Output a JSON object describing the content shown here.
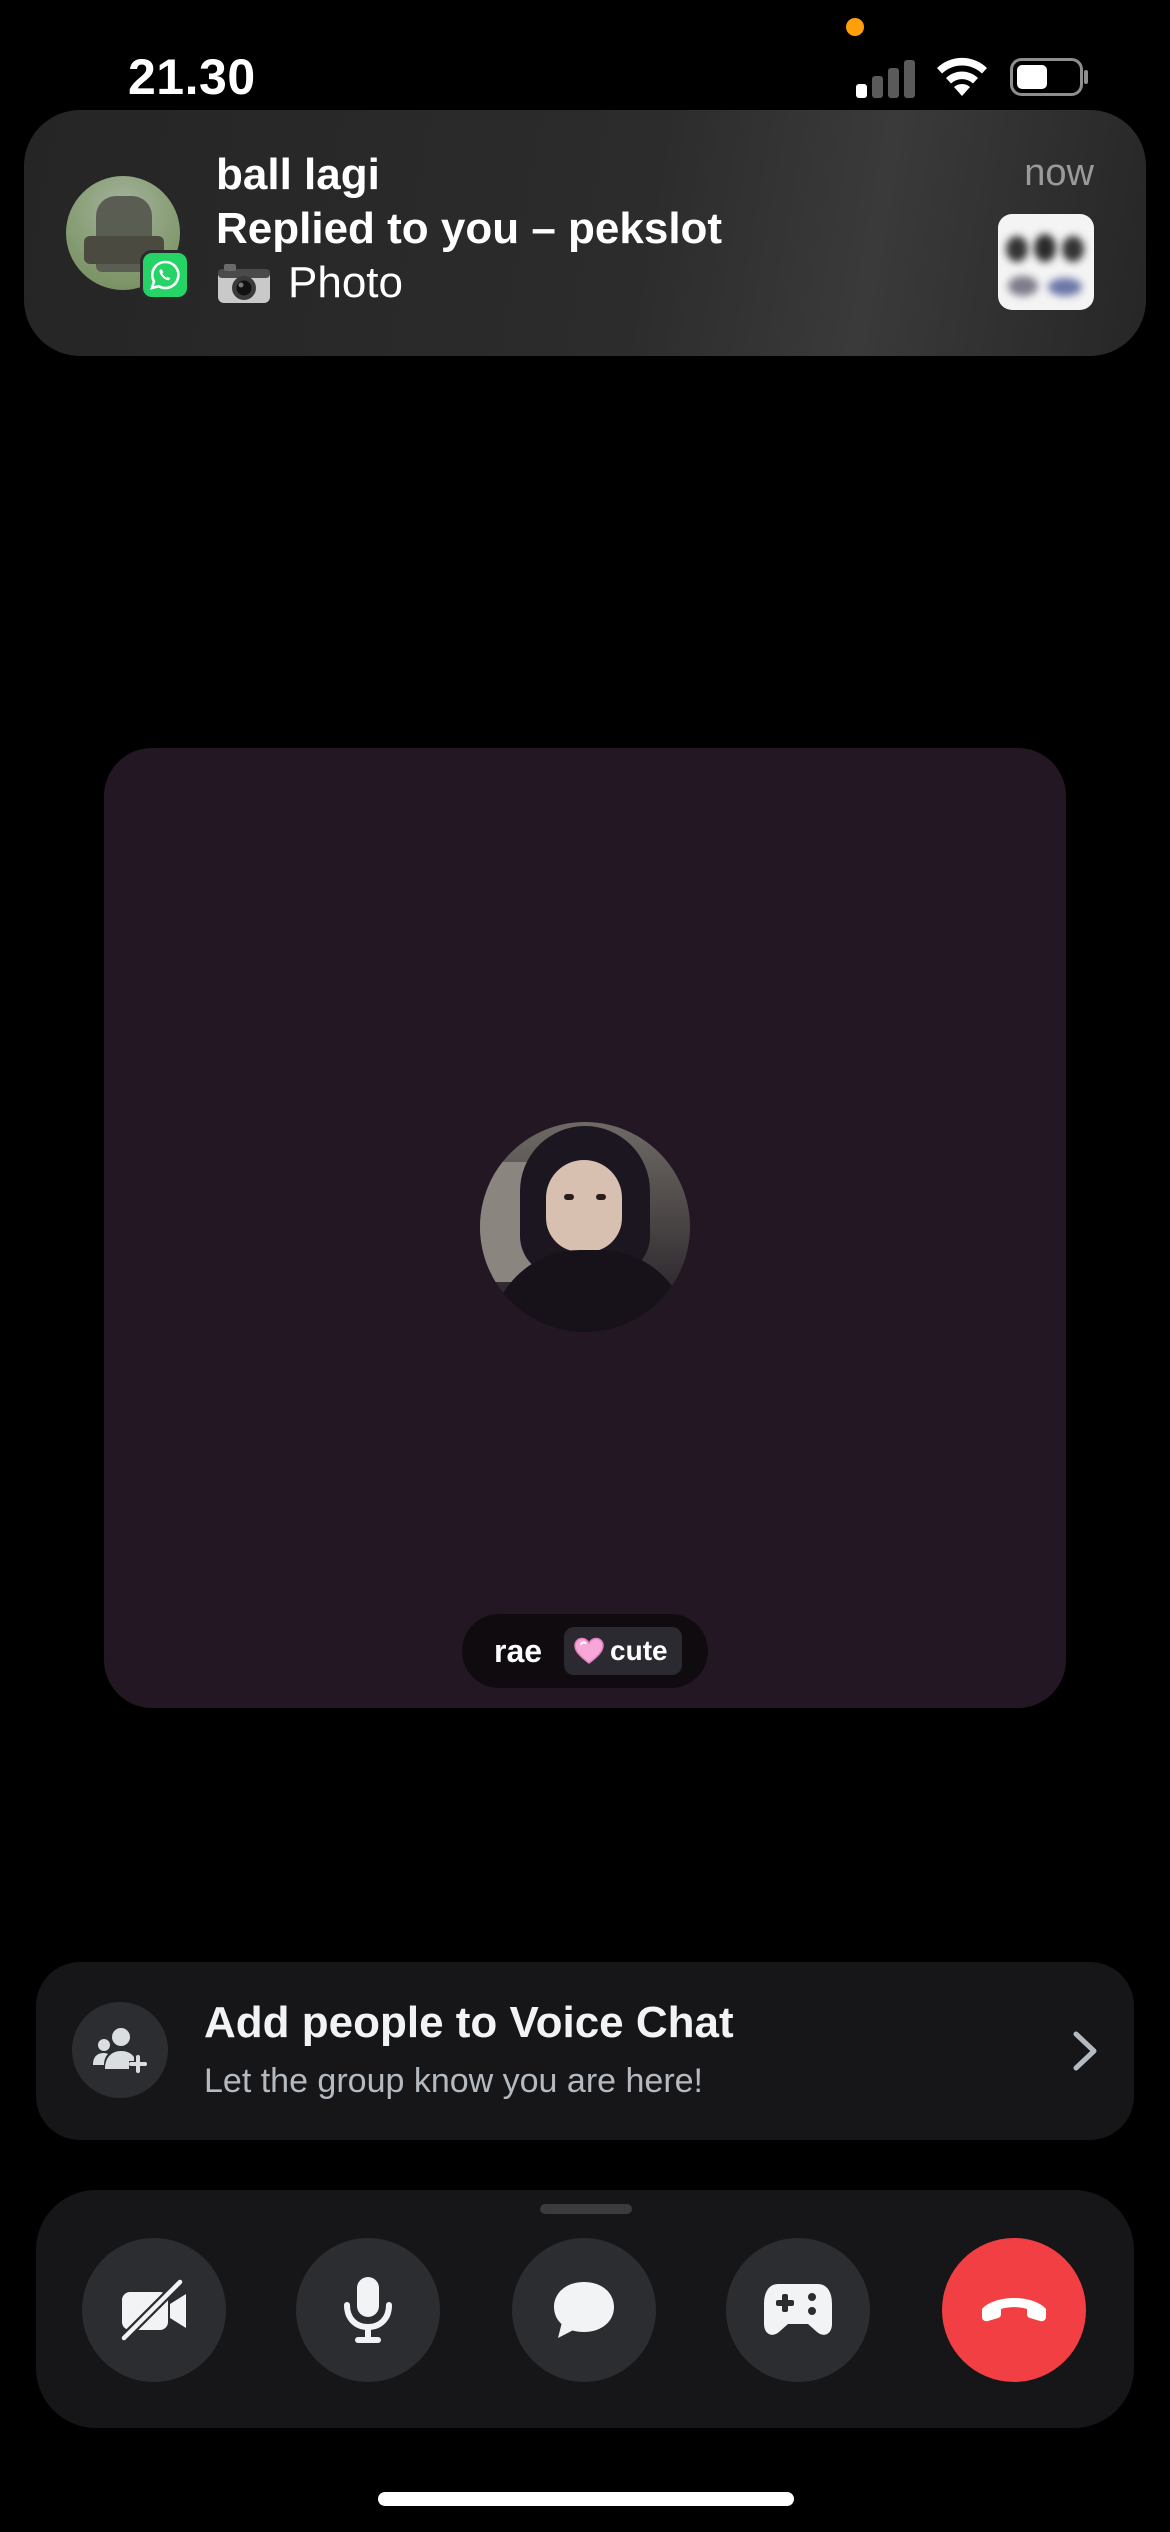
{
  "status_bar": {
    "time": "21.30",
    "privacy_dot_color": "#ff9f0a",
    "icons": [
      "cellular-signal-icon",
      "wifi-icon",
      "battery-icon"
    ]
  },
  "notification": {
    "app_icon": "whatsapp-icon",
    "title": "ball lagi",
    "subtitle": "Replied to you – pekslot",
    "body_icon": "camera-icon",
    "body": "Photo",
    "time": "now"
  },
  "call": {
    "participant": {
      "name": "rae",
      "tag_icon": "heart-icon",
      "tag": "cute"
    },
    "tile_color": "#221722"
  },
  "add_people": {
    "icon": "add-person-icon",
    "title": "Add people to Voice Chat",
    "subtitle": "Let the group know you are here!"
  },
  "controls": {
    "buttons": [
      {
        "name": "camera-off-button",
        "icon": "video-off-icon"
      },
      {
        "name": "mute-button",
        "icon": "microphone-icon"
      },
      {
        "name": "chat-button",
        "icon": "chat-bubble-icon"
      },
      {
        "name": "activities-button",
        "icon": "gamepad-icon"
      },
      {
        "name": "end-call-button",
        "icon": "hang-up-icon"
      }
    ],
    "end_call_color": "#f23f43"
  }
}
